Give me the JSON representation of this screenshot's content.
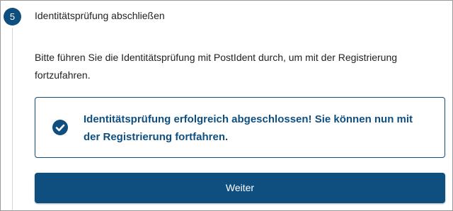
{
  "step": {
    "number": "5",
    "title": "Identitätsprüfung abschließen"
  },
  "intro_text": "Bitte führen Sie die Identitätsprüfung mit PostIdent durch, um mit der Registrierung fortzufahren.",
  "success": {
    "icon": "check-circle-icon",
    "message": "Identitätsprüfung erfolgreich abgeschlossen! Sie können nun mit der Registrierung fortfahren."
  },
  "continue_label": "Weiter",
  "colors": {
    "accent": "#0f4f80",
    "text": "#222222",
    "border": "#9a9a9a"
  }
}
